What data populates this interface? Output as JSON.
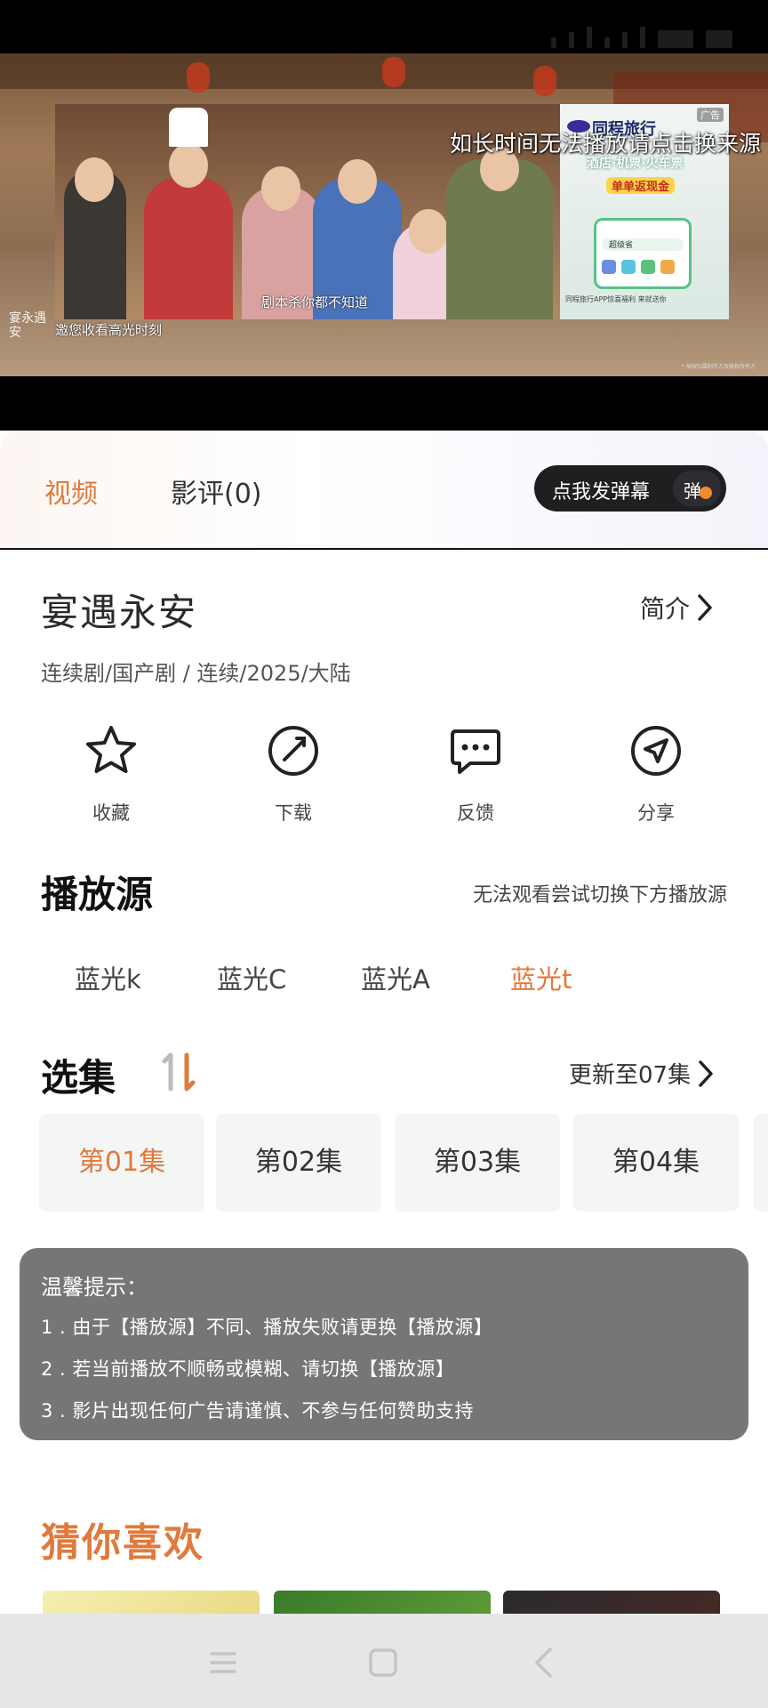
{
  "video": {
    "overlay_notice": "如长时间无法播放请点击换来源",
    "subtitle": "剧本杀你都不知道",
    "highlight_text": "邀您收看高光时刻",
    "show_logo_text": "宴永遇安",
    "copyright_text": "* 版权归属制作方及版权所有方"
  },
  "ad": {
    "label": "广告",
    "brand": "同程旅行",
    "subtitle": "酒店·机票·火车票",
    "tag": "单单返现金",
    "search_text": "超级省",
    "footer": "同程旅行APP惊喜福利 来就送你"
  },
  "tabs": {
    "video": "视频",
    "review": "影评(0)"
  },
  "danmaku": {
    "label": "点我发弹幕",
    "toggle": "弹"
  },
  "show": {
    "title": "宴遇永安",
    "intro_label": "简介",
    "meta": "连续剧/国产剧 / 连续/2025/大陆"
  },
  "actions": [
    {
      "label": "收藏",
      "icon": "star-icon"
    },
    {
      "label": "下载",
      "icon": "download-icon"
    },
    {
      "label": "反馈",
      "icon": "feedback-icon"
    },
    {
      "label": "分享",
      "icon": "share-icon"
    }
  ],
  "sources": {
    "title": "播放源",
    "hint": "无法观看尝试切换下方播放源",
    "items": [
      "蓝光k",
      "蓝光C",
      "蓝光A",
      "蓝光t"
    ],
    "active_index": 3
  },
  "episodes": {
    "title": "选集",
    "update": "更新至07集",
    "items": [
      "第01集",
      "第02集",
      "第03集",
      "第04集"
    ],
    "active_index": 0
  },
  "tips": {
    "title": "温馨提示：",
    "lines": [
      "1 . 由于【播放源】不同、播放失败请更换【播放源】",
      "2 . 若当前播放不顺畅或模糊、请切换【播放源】",
      "3 . 影片出现任何广告请谨慎、不参与任何赞助支持"
    ]
  },
  "recommend": {
    "title": "猜你喜欢"
  },
  "colors": {
    "accent": "#e07a3c",
    "tips_bg": "#767676",
    "danmaku_bg": "#1f1f22"
  }
}
